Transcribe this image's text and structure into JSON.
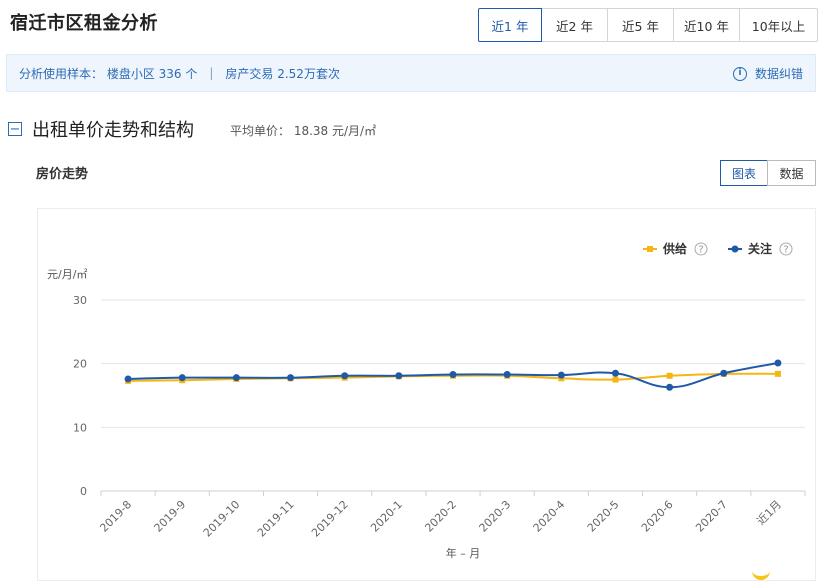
{
  "page": {
    "title": "宿迁市区租金分析"
  },
  "range_tabs": [
    {
      "label": "近1 年",
      "active": true
    },
    {
      "label": "近2 年",
      "active": false
    },
    {
      "label": "近5 年",
      "active": false
    },
    {
      "label": "近10 年",
      "active": false
    },
    {
      "label": "10年以上",
      "active": false
    }
  ],
  "sample": {
    "communities": "分析使用样本： 楼盘小区 336 个",
    "separator": "|",
    "transactions": "房产交易 2.52万套次",
    "feedback_label": "数据纠错",
    "info_icon": "i"
  },
  "section": {
    "collapse_symbol": "−",
    "title": "出租单价走势和结构",
    "avg_price": "平均单价： 18.38 元/月/㎡"
  },
  "trend": {
    "title": "房价走势",
    "view_chart": "图表",
    "view_data": "数据"
  },
  "colors": {
    "supply": "#f5b514",
    "attention": "#1f5aa8",
    "grid": "#e6e6e6"
  },
  "chart_data": {
    "type": "line",
    "ylabel": "元/月/㎡",
    "xlabel": "年 – 月",
    "ylim": [
      0,
      30
    ],
    "yticks": [
      0,
      10,
      20,
      30
    ],
    "grid": true,
    "legend_position": "top-right",
    "categories": [
      "2019-8",
      "2019-9",
      "2019-10",
      "2019-11",
      "2019-12",
      "2020-1",
      "2020-2",
      "2020-3",
      "2020-4",
      "2020-5",
      "2020-6",
      "2020-7",
      "近1月"
    ],
    "series": [
      {
        "name": "供给",
        "marker": "square",
        "help": "?",
        "values": [
          17.3,
          17.4,
          17.6,
          17.7,
          17.8,
          18.0,
          18.1,
          18.1,
          17.7,
          17.5,
          18.1,
          18.4,
          18.4
        ]
      },
      {
        "name": "关注",
        "marker": "circle",
        "help": "?",
        "values": [
          17.6,
          17.8,
          17.8,
          17.8,
          18.1,
          18.1,
          18.3,
          18.3,
          18.2,
          18.5,
          16.3,
          18.5,
          20.1
        ]
      }
    ]
  }
}
